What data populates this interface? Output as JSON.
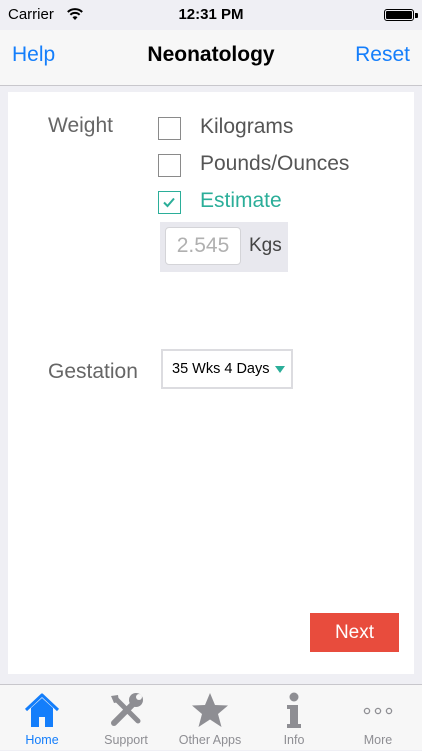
{
  "status_bar": {
    "carrier": "Carrier",
    "time": "12:31 PM"
  },
  "nav": {
    "left": "Help",
    "title": "Neonatology",
    "right": "Reset"
  },
  "weight": {
    "label": "Weight",
    "options": [
      {
        "label": "Kilograms",
        "checked": false
      },
      {
        "label": "Pounds/Ounces",
        "checked": false
      },
      {
        "label": "Estimate",
        "checked": true
      }
    ],
    "estimate_value": "2.545",
    "unit": "Kgs"
  },
  "gestation": {
    "label": "Gestation",
    "value": "35 Wks 4 Days"
  },
  "next_label": "Next",
  "tabs": [
    {
      "label": "Home",
      "icon": "home-icon",
      "active": true
    },
    {
      "label": "Support",
      "icon": "tools-icon",
      "active": false
    },
    {
      "label": "Other Apps",
      "icon": "star-icon",
      "active": false
    },
    {
      "label": "Info",
      "icon": "info-icon",
      "active": false
    },
    {
      "label": "More",
      "icon": "more-icon",
      "active": false
    }
  ],
  "colors": {
    "accent": "#147efb",
    "check": "#2bae99",
    "next": "#e84c3d"
  }
}
